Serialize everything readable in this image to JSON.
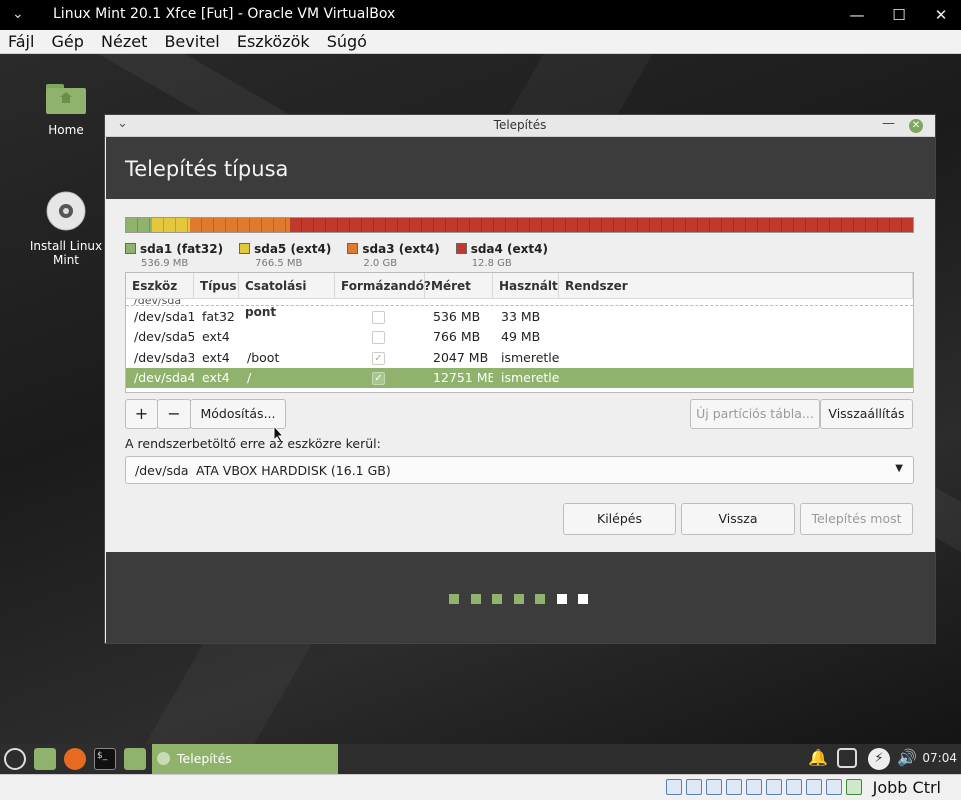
{
  "vbox": {
    "title": "Linux Mint 20.1 Xfce [Fut] - Oracle VM VirtualBox",
    "menu": [
      "Fájl",
      "Gép",
      "Nézet",
      "Bevitel",
      "Eszközök",
      "Súgó"
    ],
    "host_key": "Jobb Ctrl"
  },
  "desktop": {
    "icons": [
      {
        "label": "Home"
      },
      {
        "label": "Install Linux Mint"
      }
    ]
  },
  "installer": {
    "window_title": "Telepítés",
    "heading": "Telepítés típusa",
    "partitions": [
      {
        "name": "sda1 (fat32)",
        "size": "536.9 MB",
        "color": "#8fb26c",
        "fraction": 0.033
      },
      {
        "name": "sda5 (ext4)",
        "size": "766.5 MB",
        "color": "#e3c73d",
        "fraction": 0.048
      },
      {
        "name": "sda3 (ext4)",
        "size": "2.0 GB",
        "color": "#e07a2c",
        "fraction": 0.127
      },
      {
        "name": "sda4 (ext4)",
        "size": "12.8 GB",
        "color": "#c0392b",
        "fraction": 0.792
      }
    ],
    "table": {
      "headers": [
        "Eszköz",
        "Típus",
        "Csatolási pont",
        "Formázandó?",
        "Méret",
        "Használt",
        "Rendszer"
      ],
      "cut_row": "/dev/sda",
      "rows": [
        {
          "device": "/dev/sda1",
          "type": "fat32",
          "mount": "",
          "format": false,
          "size": "536 MB",
          "used": "33 MB",
          "system": ""
        },
        {
          "device": "/dev/sda5",
          "type": "ext4",
          "mount": "",
          "format": false,
          "size": "766 MB",
          "used": "49 MB",
          "system": ""
        },
        {
          "device": "/dev/sda3",
          "type": "ext4",
          "mount": "/boot",
          "format": true,
          "size": "2047 MB",
          "used": "ismeretlen",
          "system": ""
        },
        {
          "device": "/dev/sda4",
          "type": "ext4",
          "mount": "/",
          "format": true,
          "size": "12751 MB",
          "used": "ismeretlen",
          "system": ""
        }
      ]
    },
    "buttons": {
      "add": "+",
      "remove": "−",
      "change": "Módosítás...",
      "new_table": "Új partíciós tábla...",
      "revert": "Visszaállítás",
      "quit": "Kilépés",
      "back": "Vissza",
      "install_now": "Telepítés most"
    },
    "bootloader_label": "A rendszerbetöltő erre az eszközre kerül:",
    "bootloader_device": "/dev/sda",
    "bootloader_desc": "ATA VBOX HARDDISK (16.1 GB)",
    "progress": {
      "total_steps": 7,
      "completed_steps": 5
    }
  },
  "taskbar": {
    "task_label": "Telepítés",
    "clock": "07:04"
  },
  "colors": {
    "accent": "#8fb26c",
    "header_dark": "#3c3c3c"
  }
}
